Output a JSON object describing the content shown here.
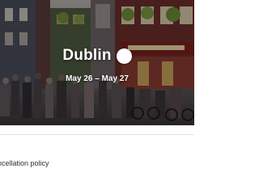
{
  "trip": {
    "destination": "Dublin",
    "dates": "May 26 – May 27",
    "edit_icon": "pencil-icon",
    "hero_image": "dublin-temple-bar-street-photo"
  },
  "details": {
    "policy_label": "ncellation policy"
  },
  "colors": {
    "hero_overlay": "#00000055",
    "divider": "#e3e3e3",
    "text": "#2f2f2f"
  }
}
